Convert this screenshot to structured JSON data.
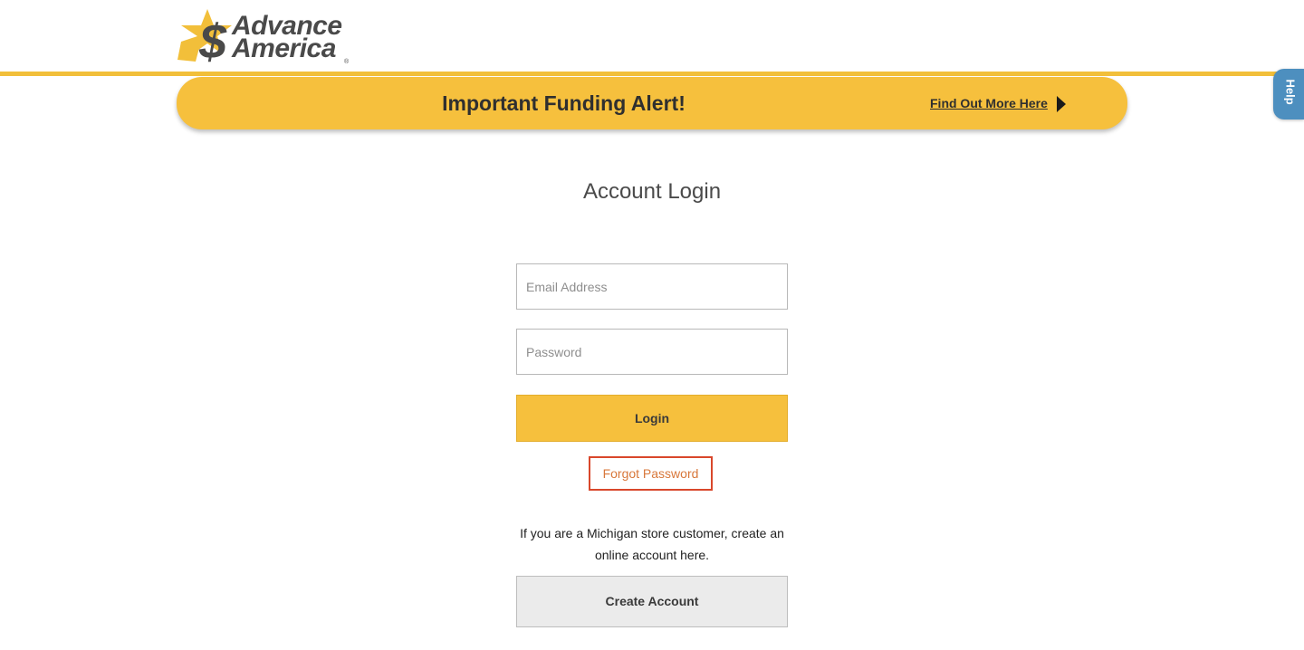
{
  "brand": {
    "name_line1": "Advance",
    "name_line2": "America",
    "registered": "®"
  },
  "alert": {
    "title": "Important Funding Alert!",
    "link_label": "Find Out More Here"
  },
  "help_tab": {
    "label": "Help"
  },
  "login": {
    "title": "Account Login",
    "email_placeholder": "Email Address",
    "password_placeholder": "Password",
    "login_label": "Login",
    "forgot_label": "Forgot Password",
    "michigan_text": "If you are a Michigan store customer, create an online account here.",
    "create_label": "Create Account"
  },
  "colors": {
    "brand_gold": "#f6c03d",
    "logo_gray": "#4a4a4a",
    "help_blue": "#4d8fbf",
    "forgot_border": "#d9472b",
    "forgot_text": "#d8773a"
  }
}
